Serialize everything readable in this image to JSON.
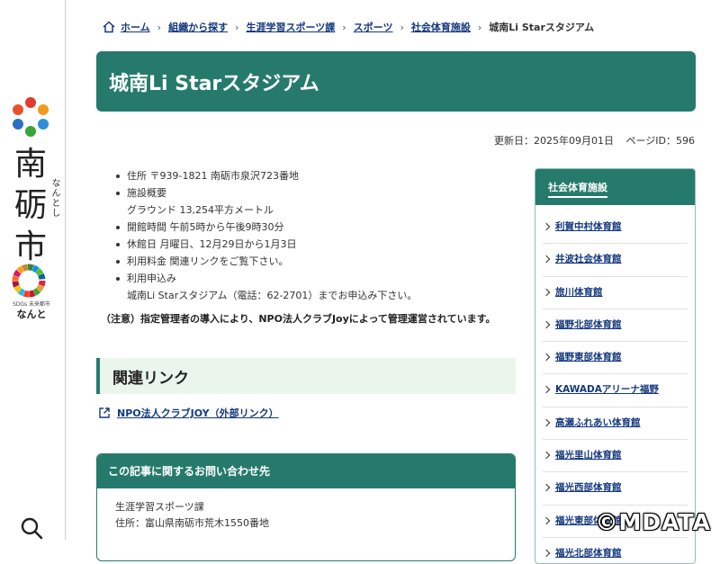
{
  "rail": {
    "city_kanji": "南\n砺\n市",
    "city_kana": "なんとし",
    "sdgs_text": "SDGs 未来都市",
    "sdgs_kana": "なんと"
  },
  "breadcrumb": {
    "items": [
      "ホーム",
      "組織から探す",
      "生涯学習スポーツ課",
      "スポーツ",
      "社会体育施設"
    ],
    "current": "城南Li Starスタジアム"
  },
  "page": {
    "title": "城南Li Starスタジアム",
    "updated": "更新日：2025年09月01日",
    "page_id": "ページID：596"
  },
  "info": {
    "address": "住所 〒939-1821 南砺市泉沢723番地",
    "overview_label": "施設概要",
    "overview_detail": "グラウンド 13,254平方メートル",
    "hours": "開館時間 午前5時から午後9時30分",
    "closed": "休館日 月曜日、12月29日から1月3日",
    "fee": "利用料金 関連リンクをご覧下さい。",
    "apply_label": "利用申込み",
    "apply_detail": "城南Li Starスタジアム（電話：62-2701）までお申込み下さい。",
    "note": "（注意）指定管理者の導入により、NPO法人クラブJoyによって管理運営されています。"
  },
  "related": {
    "heading": "関連リンク",
    "link": "NPO法人クラブJOY（外部リンク）"
  },
  "contact": {
    "heading": "この記事に関するお問い合わせ先",
    "dept": "生涯学習スポーツ課",
    "address": "住所：富山県南砺市荒木1550番地"
  },
  "sidebar": {
    "heading": "社会体育施設",
    "items": [
      "利賀中村体育館",
      "井波社会体育館",
      "旅川体育館",
      "福野北部体育館",
      "福野東部体育館",
      "KAWADAアリーナ福野",
      "高瀬ふれあい体育館",
      "福光里山体育館",
      "福光西部体育館",
      "福光東部体育館",
      "福光北部体育館"
    ]
  },
  "watermark": "©MDATA",
  "colors": {
    "brand": "#267a6c",
    "link": "#14387f",
    "related_bg": "#eaf5eb"
  }
}
